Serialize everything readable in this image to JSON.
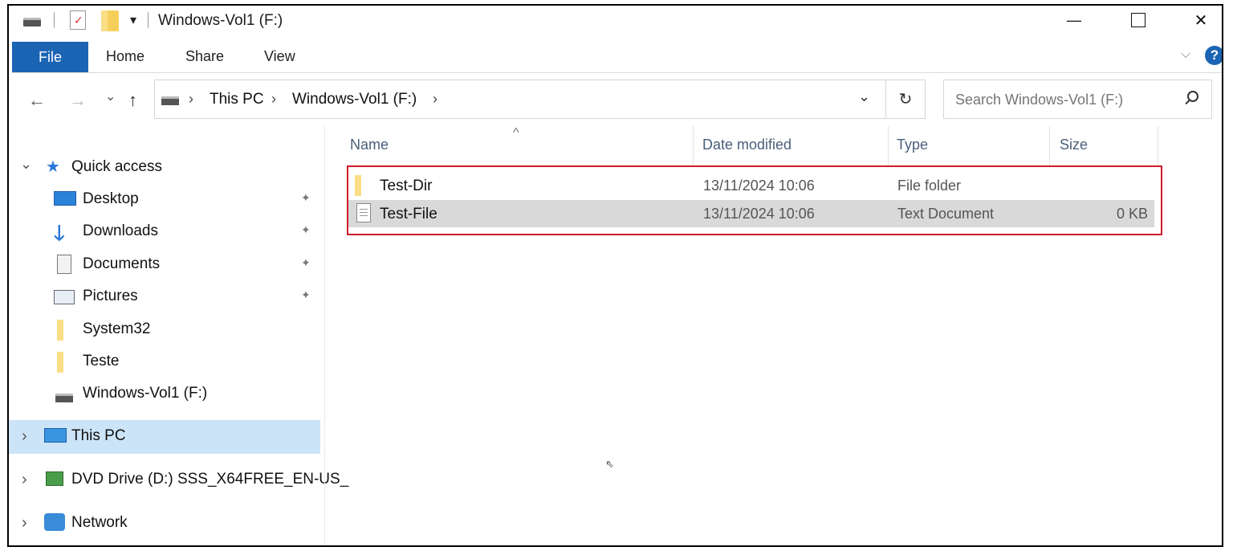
{
  "window": {
    "title": "Windows-Vol1 (F:)",
    "minimize_glyph": "—",
    "maximize_glyph": "☐",
    "close_glyph": "✕"
  },
  "ribbon": {
    "tabs": [
      "File",
      "Home",
      "Share",
      "View"
    ],
    "expand_glyph": "⌵",
    "help_glyph": "?"
  },
  "address_bar": {
    "back_glyph": "←",
    "forward_glyph": "→",
    "recent_glyph": "⌄",
    "up_glyph": "↑",
    "crumbs": [
      "This PC",
      "Windows-Vol1 (F:)"
    ],
    "separator": "›",
    "dropdown_glyph": "⌄",
    "refresh_glyph": "↻",
    "search_placeholder": "Search Windows-Vol1 (F:)"
  },
  "nav_pane": {
    "quick_access": "Quick access",
    "items": [
      {
        "label": "Desktop",
        "icon": "desktop-icon",
        "pinned": true
      },
      {
        "label": "Downloads",
        "icon": "download-arrow-icon",
        "pinned": true
      },
      {
        "label": "Documents",
        "icon": "documents-icon",
        "pinned": true
      },
      {
        "label": "Pictures",
        "icon": "pictures-icon",
        "pinned": true
      },
      {
        "label": "System32",
        "icon": "folder-icon",
        "pinned": false
      },
      {
        "label": "Teste",
        "icon": "folder-icon",
        "pinned": false
      },
      {
        "label": "Windows-Vol1 (F:)",
        "icon": "drive-icon",
        "pinned": false
      }
    ],
    "this_pc": "This PC",
    "dvd_drive": "DVD Drive (D:) SSS_X64FREE_EN-US_",
    "network": "Network",
    "pin_glyph": "📌",
    "expand_glyph": "›",
    "collapse_glyph": "⌄"
  },
  "file_list": {
    "sort_glyph": "^",
    "columns": {
      "name": "Name",
      "date": "Date modified",
      "type": "Type",
      "size": "Size"
    },
    "rows": [
      {
        "name": "Test-Dir",
        "date": "13/11/2024 10:06",
        "type": "File folder",
        "size": "",
        "icon": "folder-icon"
      },
      {
        "name": "Test-File",
        "date": "13/11/2024 10:06",
        "type": "Text Document",
        "size": "0 KB",
        "icon": "text-document-icon"
      }
    ]
  },
  "colors": {
    "file_tab": "#1b64b4",
    "selected_nav": "#cce4f7",
    "selected_row": "#d9d9d9",
    "highlight_border": "#d11b2a",
    "folder": "#f6cf5b"
  }
}
